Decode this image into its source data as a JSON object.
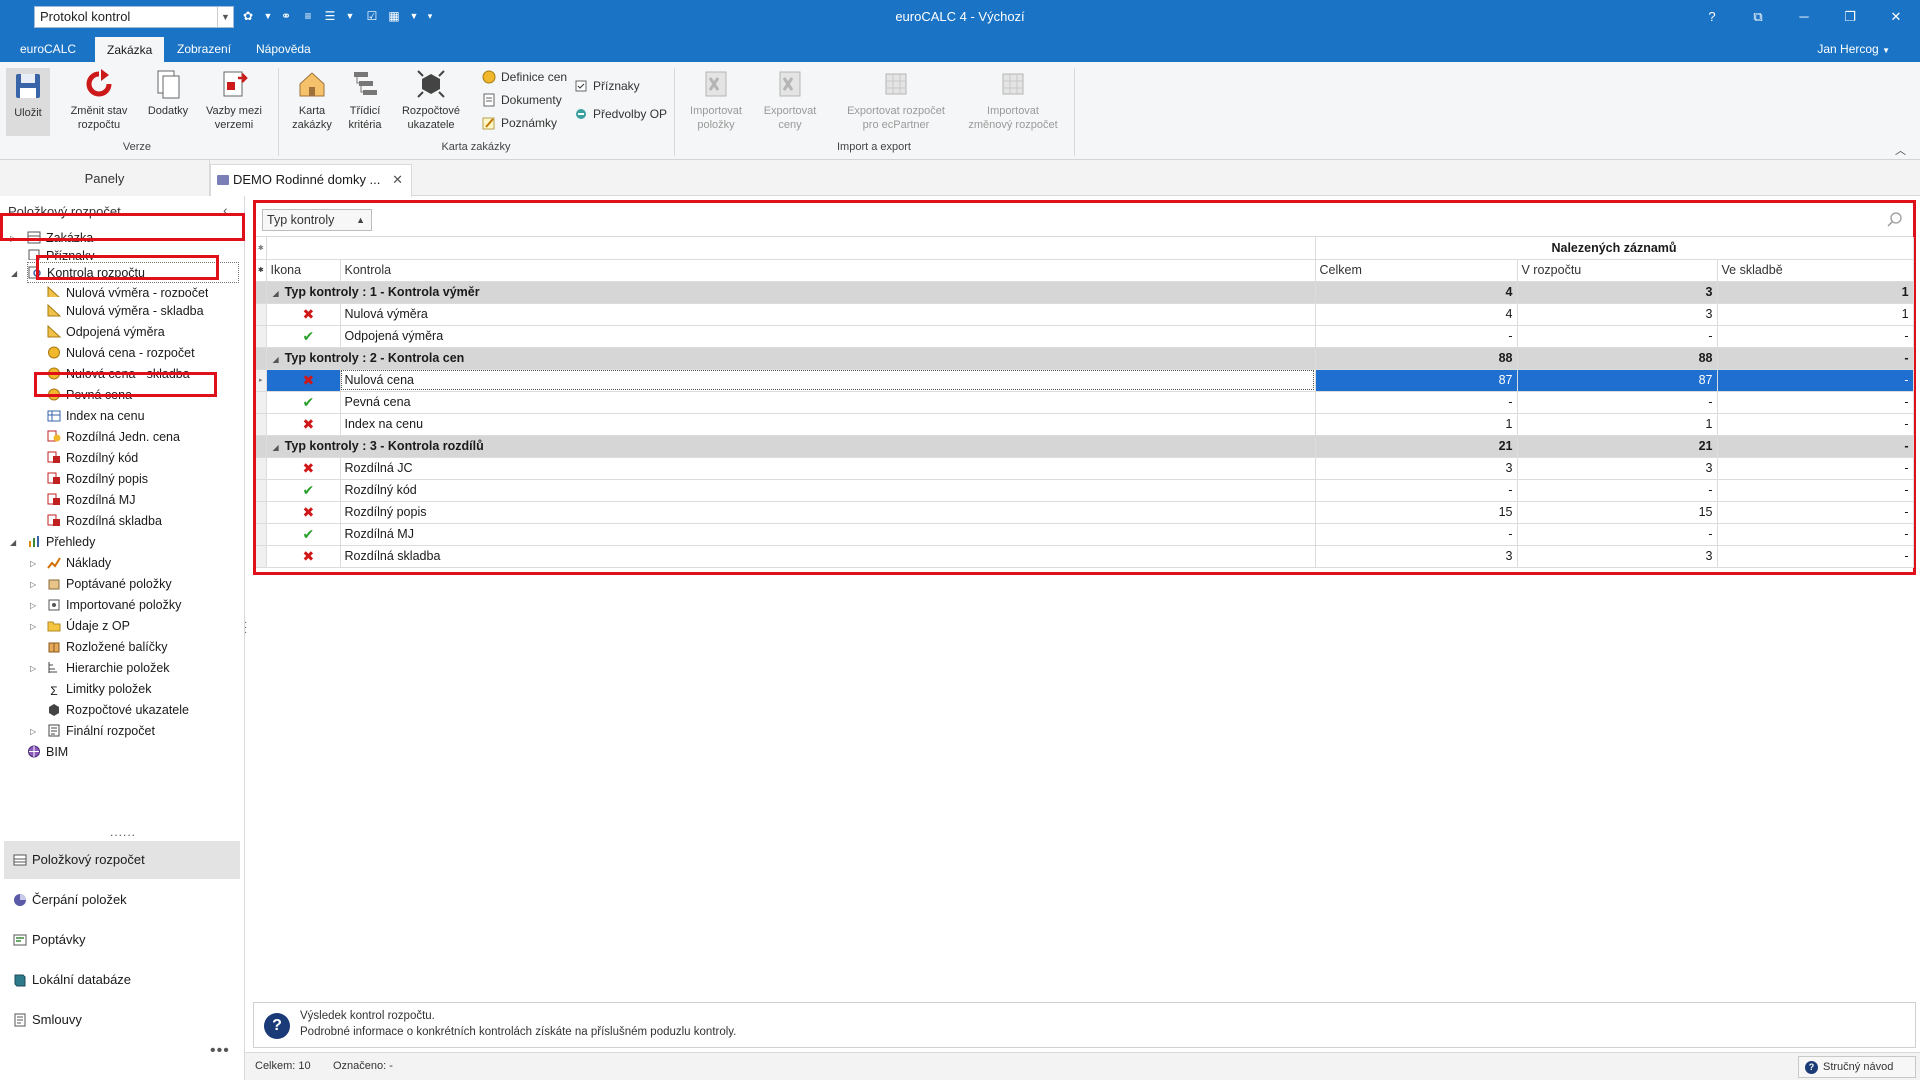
{
  "titlebar": {
    "qat_select": "Protokol kontrol",
    "app_title": "euroCALC 4 - Výchozí",
    "help_button": "?",
    "user": "Jan Hercog"
  },
  "ribbon_tabs": [
    "euroCALC",
    "Zakázka",
    "Zobrazení",
    "Nápověda"
  ],
  "ribbon": {
    "ulozit": "Uložit",
    "zmenit_stav": [
      "Změnit stav",
      "rozpočtu"
    ],
    "dodatky": "Dodatky",
    "vazby": [
      "Vazby mezi",
      "verzemi"
    ],
    "karta_zakazky": [
      "Karta",
      "zakázky"
    ],
    "tridici_kriteria": [
      "Třídicí",
      "kritéria"
    ],
    "rozpoctove_ukazatele": [
      "Rozpočtové",
      "ukazatele"
    ],
    "definice_cen": "Definice cen",
    "dokumenty": "Dokumenty",
    "poznamky": "Poznámky",
    "priznaky": "Příznaky",
    "predvolby_op": "Předvolby OP",
    "importovat_polozky": [
      "Importovat",
      "položky"
    ],
    "exportovat_ceny": [
      "Exportovat",
      "ceny"
    ],
    "exportovat_ecpartner": [
      "Exportovat rozpočet",
      "pro ecPartner"
    ],
    "importovat_zmenovy": [
      "Importovat",
      "změnový rozpočet"
    ],
    "group_verze": "Verze",
    "group_karta": "Karta zakázky",
    "group_import": "Import a export"
  },
  "panels_label": "Panely",
  "doc_tab": "DEMO Rodinné domky ...",
  "left_panel": {
    "title": "Položkový rozpočet",
    "tree": [
      {
        "label": "Zakázka"
      },
      {
        "label": "Příznaky"
      },
      {
        "label": "Kontrola rozpočtu"
      },
      {
        "label": "Nulová výměra - rozpočet"
      },
      {
        "label": "Nulová výměra - skladba"
      },
      {
        "label": "Odpojená výměra"
      },
      {
        "label": "Nulová cena - rozpočet"
      },
      {
        "label": "Nulová cena - skladba"
      },
      {
        "label": "Pevná cena"
      },
      {
        "label": "Index na cenu"
      },
      {
        "label": "Rozdílná Jedn. cena"
      },
      {
        "label": "Rozdílný kód"
      },
      {
        "label": "Rozdílný popis"
      },
      {
        "label": "Rozdílná MJ"
      },
      {
        "label": "Rozdílná skladba"
      },
      {
        "label": "Přehledy"
      },
      {
        "label": "Náklady"
      },
      {
        "label": "Poptávané položky"
      },
      {
        "label": "Importované položky"
      },
      {
        "label": "Údaje z OP"
      },
      {
        "label": "Rozložené balíčky"
      },
      {
        "label": "Hierarchie položek"
      },
      {
        "label": "Limitky položek"
      },
      {
        "label": "Rozpočtové ukazatele"
      },
      {
        "label": "Finální rozpočet"
      },
      {
        "label": "BIM"
      }
    ],
    "nav": [
      "Položkový rozpočet",
      "Čerpání položek",
      "Poptávky",
      "Lokální databáze",
      "Smlouvy"
    ]
  },
  "grid": {
    "group_chip": "Typ kontroly",
    "band_header": "Nalezených záznamů",
    "columns": [
      "Ikona",
      "Kontrola",
      "Celkem",
      "V rozpočtu",
      "Ve skladbě"
    ],
    "rows": [
      {
        "type": "group",
        "label": "Typ kontroly : 1 - Kontrola výměr",
        "celkem": "4",
        "rozpocet": "3",
        "skladba": "1"
      },
      {
        "type": "item",
        "ok": false,
        "label": "Nulová výměra",
        "celkem": "4",
        "rozpocet": "3",
        "skladba": "1"
      },
      {
        "type": "item",
        "ok": true,
        "label": "Odpojená výměra",
        "celkem": "-",
        "rozpocet": "-",
        "skladba": "-"
      },
      {
        "type": "group",
        "label": "Typ kontroly : 2 - Kontrola cen",
        "celkem": "88",
        "rozpocet": "88",
        "skladba": "-"
      },
      {
        "type": "item",
        "ok": false,
        "label": "Nulová cena",
        "celkem": "87",
        "rozpocet": "87",
        "skladba": "-",
        "selected": true
      },
      {
        "type": "item",
        "ok": true,
        "label": "Pevná cena",
        "celkem": "-",
        "rozpocet": "-",
        "skladba": "-"
      },
      {
        "type": "item",
        "ok": false,
        "label": "Index na cenu",
        "celkem": "1",
        "rozpocet": "1",
        "skladba": "-"
      },
      {
        "type": "group",
        "label": "Typ kontroly : 3 - Kontrola rozdílů",
        "celkem": "21",
        "rozpocet": "21",
        "skladba": "-"
      },
      {
        "type": "item",
        "ok": false,
        "label": "Rozdílná JC",
        "celkem": "3",
        "rozpocet": "3",
        "skladba": "-"
      },
      {
        "type": "item",
        "ok": true,
        "label": "Rozdílný kód",
        "celkem": "-",
        "rozpocet": "-",
        "skladba": "-"
      },
      {
        "type": "item",
        "ok": false,
        "label": "Rozdílný popis",
        "celkem": "15",
        "rozpocet": "15",
        "skladba": "-"
      },
      {
        "type": "item",
        "ok": true,
        "label": "Rozdílná MJ",
        "celkem": "-",
        "rozpocet": "-",
        "skladba": "-"
      },
      {
        "type": "item",
        "ok": false,
        "label": "Rozdílná skladba",
        "celkem": "3",
        "rozpocet": "3",
        "skladba": "-"
      }
    ]
  },
  "info": {
    "line1": "Výsledek kontrol rozpočtu.",
    "line2": "Podrobné informace o konkrétních kontrolách získáte na příslušném poduzlu kontroly."
  },
  "status": {
    "celkem": "Celkem: 10",
    "oznaceno": "Označeno: -",
    "help": "Stručný návod"
  },
  "colors": {
    "titlebar": "#1a73c4",
    "highlight": "#e0101a",
    "selection": "#1f6fd0",
    "error": "#d01818",
    "ok": "#2ca02c"
  }
}
